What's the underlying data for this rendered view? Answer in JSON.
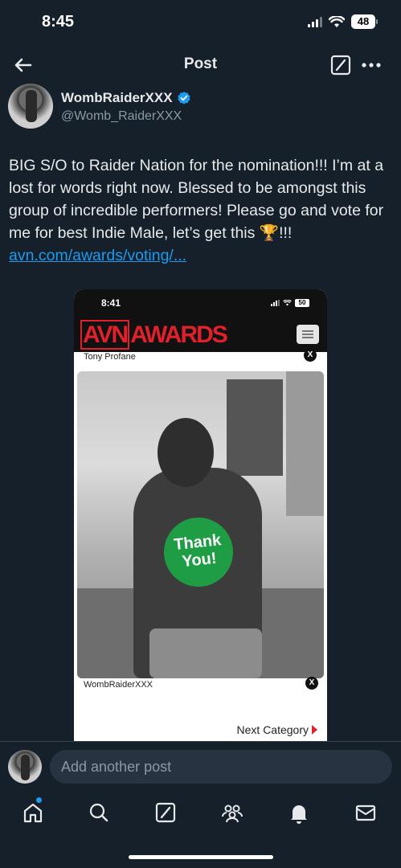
{
  "status_bar": {
    "time": "8:45",
    "battery": "48"
  },
  "header": {
    "title": "Post"
  },
  "author": {
    "name": "WombRaiderXXX",
    "handle": "@Womb_RaiderXXX"
  },
  "post": {
    "text": "BIG S/O to Raider Nation for the nomination!!! I’m at a lost for words right now. Blessed to be amongst this group of incredible performers! Please go and vote for me for best Indie Male, let’s get this 🏆!!! ",
    "link": "avn.com/awards/voting/..."
  },
  "media": {
    "inner_time": "8:41",
    "inner_battery": "50",
    "logo_box": "AVN",
    "logo_rest": "AWARDS",
    "previous_name": "Tony Profane",
    "badge_line1": "Thank",
    "badge_line2": "You!",
    "current_name": "WombRaiderXXX",
    "next_label": "Next Category",
    "x_label": "X"
  },
  "reply": {
    "placeholder": "Add another post"
  },
  "tabs": [
    "home-icon",
    "search-icon",
    "grok-icon",
    "communities-icon",
    "notifications-icon",
    "messages-icon"
  ],
  "colors": {
    "background": "#15202b",
    "accent": "#1d9bf0",
    "avn_red": "#e0202b",
    "badge_green": "#1f9d45"
  }
}
